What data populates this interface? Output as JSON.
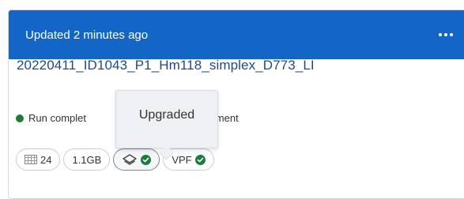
{
  "card": {
    "header_title": "Updated 2 minutes ago",
    "run_name": "20220411_ID1043_P1_Hm118_simplex_D773_LI",
    "status_text_left": "Run complet",
    "status_text_right": "instrument",
    "status_color": "#1a7d3c"
  },
  "pills": [
    {
      "icon": "grid-icon",
      "label": "24"
    },
    {
      "icon": "",
      "label": "1.1GB"
    },
    {
      "icon": "layers-icon",
      "label": ""
    },
    {
      "icon": "",
      "label": "VPF"
    }
  ],
  "tooltip": {
    "text": "Upgraded"
  },
  "colors": {
    "header_bg": "#1466c6",
    "accent_text": "#1d4a8a",
    "success": "#1a7d3c"
  }
}
